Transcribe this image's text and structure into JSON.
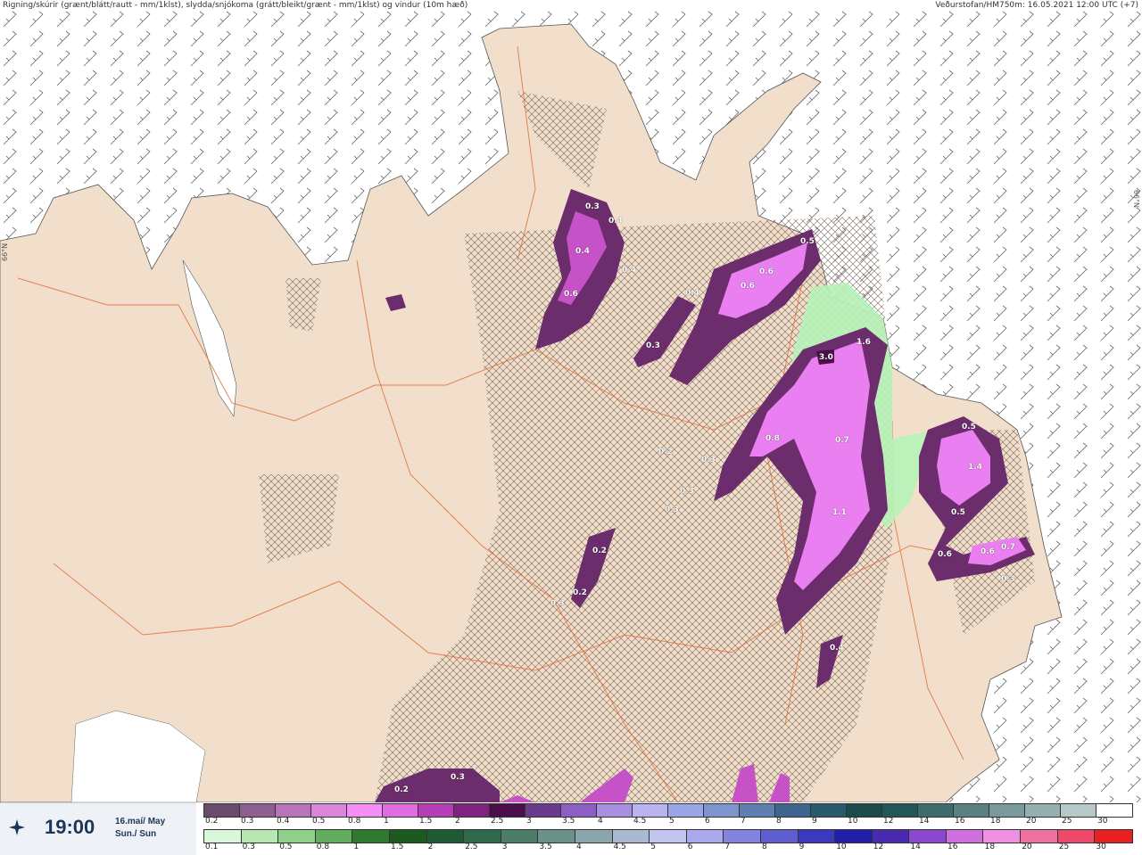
{
  "header": {
    "title": "Rigning/skúrir (grænt/blátt/rautt - mm/1klst), slydda/snjókoma (grátt/bleikt/grænt - mm/1klst) og vindur (10m hæð)",
    "source": "Veðurstofan/HM750m: 16.05.2021 12:00 UTC (+7)"
  },
  "map": {
    "grid_label_left": "66°N",
    "grid_label_right": "66°N",
    "colors": {
      "sea": "#ffffff",
      "land": "#f1dfcc",
      "roads": "#e2713a",
      "rain_light": "#b6f3b7",
      "snow_mid": "#c553c7",
      "snow_strong": "#e97ff0",
      "snow_dark": "#6b2d6b",
      "barb": "#555555"
    },
    "value_labels": [
      "0.3",
      "0.4",
      "0.4",
      "0.4",
      "0.6",
      "0.4",
      "0.3",
      "0.5",
      "0.6",
      "0.6",
      "1.6",
      "3.0",
      "0.8",
      "0.7",
      "1.1",
      "0.5",
      "1.4",
      "0.5",
      "0.6",
      "0.6",
      "0.7",
      "0.3",
      "0.3",
      "0.3",
      "0.2",
      "0.3",
      "0.2",
      "0.3",
      "0.2",
      "0.3",
      "0.4",
      "0.3"
    ]
  },
  "footer": {
    "time": "19:00",
    "date_line1": "16.maí/ May",
    "date_line2": "Sun./ Sun",
    "icon": "wind-compass-icon",
    "scale_rain_labels": [
      "0.2",
      "0.3",
      "0.4",
      "0.5",
      "0.8",
      "1",
      "1.5",
      "2",
      "2.5",
      "3",
      "3.5",
      "4",
      "4.5",
      "5",
      "6",
      "7",
      "8",
      "9",
      "10",
      "12",
      "14",
      "16",
      "18",
      "20",
      "25",
      "30"
    ],
    "scale_rain_colors": [
      "#6a4b6a",
      "#8e5f8e",
      "#b874b8",
      "#db85db",
      "#f58ff5",
      "#e06de0",
      "#b43fb4",
      "#7e237e",
      "#4a0f4a",
      "#6a3a8e",
      "#8b5fc4",
      "#a890e0",
      "#b9b3f0",
      "#9ba6e6",
      "#7d94cc",
      "#5f7fb0",
      "#3f6690",
      "#275a6a",
      "#1a4a4a",
      "#235656",
      "#3e6b6b",
      "#5a8080",
      "#789a9a",
      "#96b0b0",
      "#b7c8c8",
      "#ffffff"
    ],
    "scale_snow_labels": [
      "0.1",
      "0.3",
      "0.5",
      "0.8",
      "1",
      "1.5",
      "2",
      "2.5",
      "3",
      "3.5",
      "4",
      "4.5",
      "5",
      "6",
      "7",
      "8",
      "9",
      "10",
      "12",
      "14",
      "16",
      "18",
      "20",
      "25",
      "30"
    ],
    "scale_snow_colors": [
      "#d9f8d9",
      "#b6e8b0",
      "#8fd18a",
      "#62ad5e",
      "#2f7a2f",
      "#1d5a1d",
      "#1f5a34",
      "#2f6a4a",
      "#4d7d69",
      "#69918a",
      "#8aa6ac",
      "#a9b9cf",
      "#c1c6ef",
      "#a9a9ee",
      "#8484e0",
      "#5e5ed0",
      "#3a3ac0",
      "#1f1fa8",
      "#4a2ab0",
      "#8a48d0",
      "#d070e0",
      "#f090e0",
      "#f070a0",
      "#f04868",
      "#e82020"
    ]
  }
}
